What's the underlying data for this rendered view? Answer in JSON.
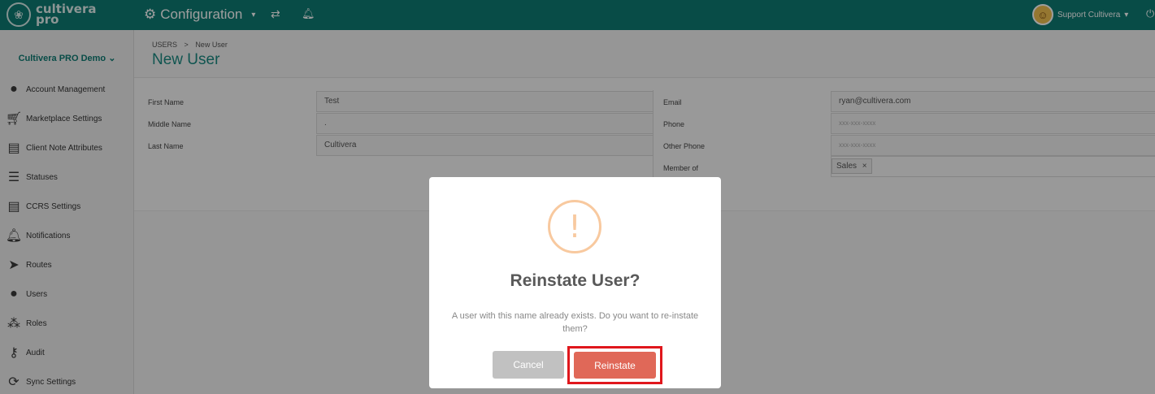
{
  "topbar": {
    "logo_line1": "cultivera",
    "logo_line2": "pro",
    "config_label": "Configuration",
    "user_name": "Support Cultivera"
  },
  "sidebar": {
    "org": "Cultivera PRO Demo",
    "items": [
      {
        "label": "Account Management",
        "icon": "user-icon"
      },
      {
        "label": "Marketplace Settings",
        "icon": "cart-icon"
      },
      {
        "label": "Client Note Attributes",
        "icon": "document-icon"
      },
      {
        "label": "Statuses",
        "icon": "list-icon"
      },
      {
        "label": "CCRS Settings",
        "icon": "document-icon"
      },
      {
        "label": "Notifications",
        "icon": "bell-icon"
      },
      {
        "label": "Routes",
        "icon": "location-arrow-icon"
      },
      {
        "label": "Users",
        "icon": "user-icon"
      },
      {
        "label": "Roles",
        "icon": "group-icon"
      },
      {
        "label": "Audit",
        "icon": "key-icon"
      },
      {
        "label": "Sync Settings",
        "icon": "sync-icon"
      }
    ]
  },
  "breadcrumb": {
    "root": "USERS",
    "separator": ">",
    "current": "New User"
  },
  "page_title": "New User",
  "form": {
    "first_name_label": "First Name",
    "first_name_value": "Test",
    "middle_name_label": "Middle Name",
    "middle_name_value": ".",
    "last_name_label": "Last Name",
    "last_name_value": "Cultivera",
    "email_label": "Email",
    "email_value": "ryan@cultivera.com",
    "phone_label": "Phone",
    "phone_placeholder": "xxx-xxx-xxxx",
    "other_phone_label": "Other Phone",
    "other_phone_placeholder": "xxx-xxx-xxxx",
    "member_of_label": "Member of",
    "member_tag": "Sales"
  },
  "modal": {
    "title": "Reinstate User?",
    "text": "A user with this name already exists. Do you want to re-instate them?",
    "cancel_label": "Cancel",
    "confirm_label": "Reinstate"
  },
  "colors": {
    "accent": "#0d7b73",
    "confirm": "#e06858",
    "warning": "#f8c99f",
    "highlight": "#e0171c"
  }
}
